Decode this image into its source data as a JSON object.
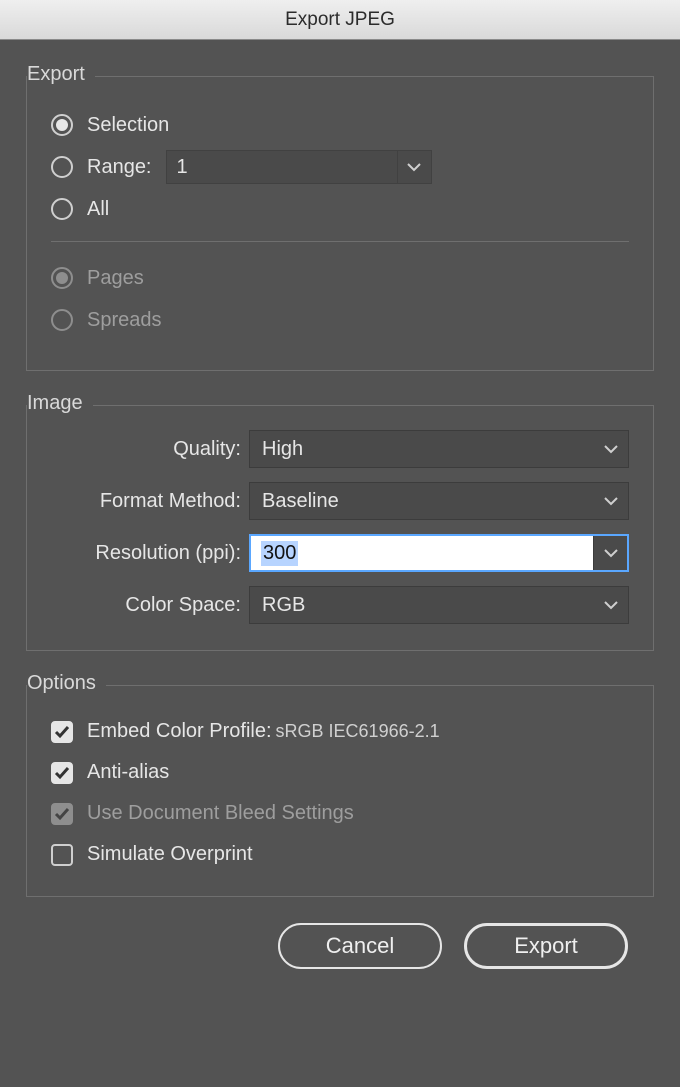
{
  "window": {
    "title": "Export JPEG"
  },
  "export": {
    "legend": "Export",
    "selection_label": "Selection",
    "range_label": "Range:",
    "range_value": "1",
    "all_label": "All",
    "pages_label": "Pages",
    "spreads_label": "Spreads"
  },
  "image": {
    "legend": "Image",
    "quality_label": "Quality:",
    "quality_value": "High",
    "format_label": "Format Method:",
    "format_value": "Baseline",
    "resolution_label": "Resolution (ppi):",
    "resolution_value": "300",
    "colorspace_label": "Color Space:",
    "colorspace_value": "RGB"
  },
  "options": {
    "legend": "Options",
    "embed_label": "Embed Color Profile:",
    "embed_profile": "sRGB IEC61966-2.1",
    "antialias_label": "Anti-alias",
    "bleed_label": "Use Document Bleed Settings",
    "overprint_label": "Simulate Overprint"
  },
  "buttons": {
    "cancel": "Cancel",
    "export": "Export"
  }
}
